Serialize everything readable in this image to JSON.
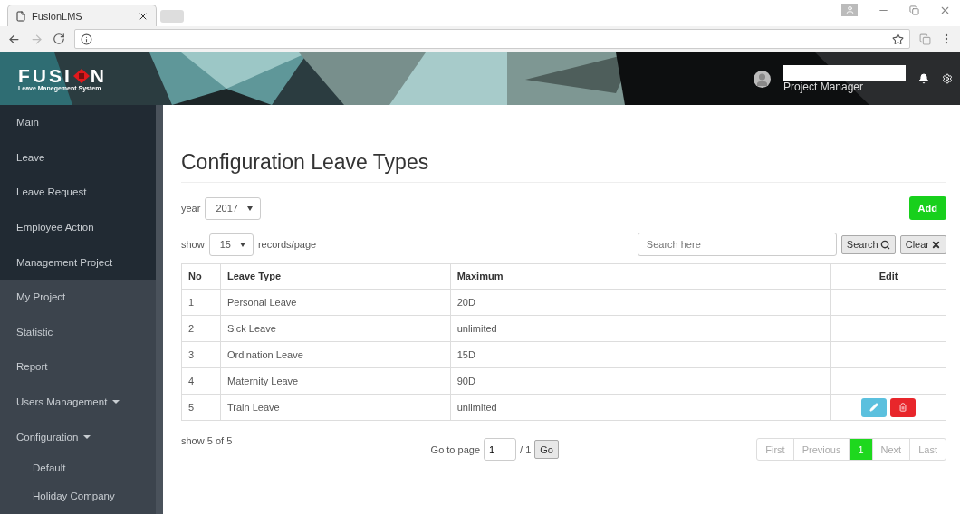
{
  "browser": {
    "tab_title": "FusionLMS"
  },
  "header": {
    "logo_title": "FUSI",
    "logo_title_end": "N",
    "logo_subtitle": "Leave Manegement System",
    "role": "Project Manager"
  },
  "sidebar": {
    "top_items": [
      {
        "label": "Main"
      },
      {
        "label": "Leave"
      },
      {
        "label": "Leave Request"
      },
      {
        "label": "Employee Action"
      },
      {
        "label": "Management Project"
      }
    ],
    "items": [
      {
        "label": "My Project",
        "kind": "link"
      },
      {
        "label": "Statistic",
        "kind": "link"
      },
      {
        "label": "Report",
        "kind": "link"
      },
      {
        "label": "Users Management",
        "kind": "menu"
      },
      {
        "label": "Configuration",
        "kind": "menu",
        "children": [
          {
            "label": "Default"
          },
          {
            "label": "Holiday Company"
          }
        ]
      }
    ]
  },
  "page": {
    "title": "Configuration Leave Types",
    "year_label": "year",
    "year": "2017",
    "add_button": "Add",
    "show_label": "show",
    "page_size": "15",
    "page_size_suffix": "records/page",
    "search": {
      "placeholder": "Search here"
    },
    "search_button": "Search",
    "clear_button": "Clear"
  },
  "table": {
    "columns": [
      "No",
      "Leave Type",
      "Maximum",
      "Edit"
    ],
    "rows": [
      {
        "no": "1",
        "leave_type": "Personal Leave",
        "maximum": "20D",
        "editable": false
      },
      {
        "no": "2",
        "leave_type": "Sick Leave",
        "maximum": "unlimited",
        "editable": false
      },
      {
        "no": "3",
        "leave_type": "Ordination Leave",
        "maximum": "15D",
        "editable": false
      },
      {
        "no": "4",
        "leave_type": "Maternity Leave",
        "maximum": "90D",
        "editable": false
      },
      {
        "no": "5",
        "leave_type": "Train Leave",
        "maximum": "unlimited",
        "editable": true
      }
    ]
  },
  "footer": {
    "summary": "show 5 of 5",
    "goto_label": "Go to page",
    "goto_value": "1",
    "goto_total": "/ 1",
    "go_button": "Go",
    "pagination": [
      {
        "label": "First",
        "selected": false
      },
      {
        "label": "Previous",
        "selected": false
      },
      {
        "label": "1",
        "selected": true
      },
      {
        "label": "Next",
        "selected": false
      },
      {
        "label": "Last",
        "selected": false
      }
    ]
  }
}
